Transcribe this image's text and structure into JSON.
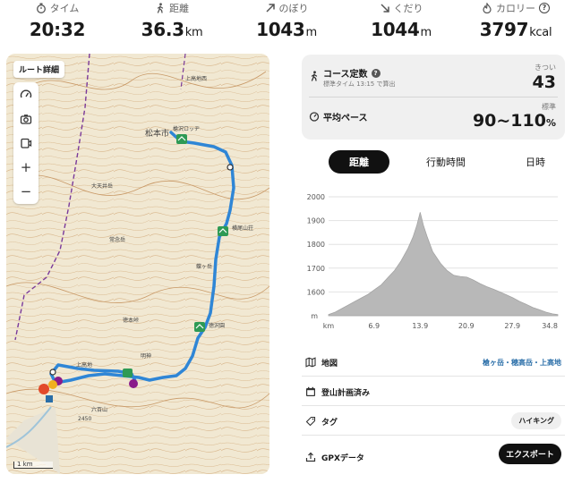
{
  "stats": [
    {
      "label": "タイム",
      "value": "20:32",
      "unit": "",
      "icon": "stopwatch-icon"
    },
    {
      "label": "距離",
      "value": "36.3",
      "unit": "km",
      "icon": "hiker-icon"
    },
    {
      "label": "のぼり",
      "value": "1043",
      "unit": "m",
      "icon": "arrow-up-right-icon"
    },
    {
      "label": "くだり",
      "value": "1044",
      "unit": "m",
      "icon": "arrow-down-right-icon"
    },
    {
      "label": "カロリー",
      "value": "3797",
      "unit": "kcal",
      "icon": "flame-icon"
    }
  ],
  "map": {
    "route_detail_label": "ルート詳細",
    "tools": [
      "speedometer-icon",
      "camera-icon",
      "share-screen-icon",
      "zoom-in-icon",
      "zoom-out-icon"
    ],
    "scale_label": "1 km",
    "place_labels": [
      "松本市",
      "槍沢ロッヂ",
      "横尾山荘",
      "徳沢園",
      "上高地",
      "明神",
      "蝶ヶ岳",
      "大天井岳",
      "常念岳",
      "徳本峠",
      "六百山",
      "2450",
      "上高地西"
    ],
    "route_color": "#2f86d6"
  },
  "course": {
    "title": "コース定数",
    "subtitle": "標準タイム 13:15 で算出",
    "difficulty_label": "きつい",
    "difficulty_value": "43"
  },
  "pace": {
    "title": "平均ペース",
    "standard_label": "標準",
    "value": "90~110",
    "unit": "%"
  },
  "tabs": [
    "距離",
    "行動時間",
    "日時"
  ],
  "chart_data": {
    "type": "area",
    "title": "",
    "xlabel": "km",
    "ylabel": "m",
    "xlim": [
      0,
      34.8
    ],
    "ylim": [
      1500,
      2000
    ],
    "x_ticks": [
      6.9,
      13.9,
      20.9,
      27.9,
      34.8
    ],
    "y_ticks": [
      1600,
      1700,
      1800,
      1900,
      2000
    ],
    "x": [
      0,
      1,
      2,
      3,
      4,
      5,
      6,
      7,
      8,
      9,
      10,
      11,
      12,
      12.8,
      13.4,
      13.9,
      14.4,
      15,
      15.8,
      17,
      18,
      19,
      20,
      21,
      22,
      23,
      24,
      25,
      26,
      27,
      28,
      29,
      30,
      31,
      32,
      33,
      34,
      34.8
    ],
    "values": [
      1505,
      1515,
      1530,
      1545,
      1560,
      1575,
      1590,
      1610,
      1630,
      1660,
      1690,
      1730,
      1780,
      1830,
      1880,
      1935,
      1880,
      1830,
      1770,
      1720,
      1690,
      1670,
      1665,
      1662,
      1650,
      1635,
      1622,
      1612,
      1600,
      1588,
      1575,
      1560,
      1548,
      1535,
      1525,
      1515,
      1508,
      1505
    ],
    "color": "#b8b8b8",
    "grid": true
  },
  "info": {
    "map_label": "地図",
    "map_value": "槍ヶ岳・穂高岳・上高地",
    "plan_label": "登山計画済み",
    "tag_label": "タグ",
    "tag_value": "ハイキング",
    "gpx_label": "GPXデータ",
    "export_label": "エクスポート"
  }
}
